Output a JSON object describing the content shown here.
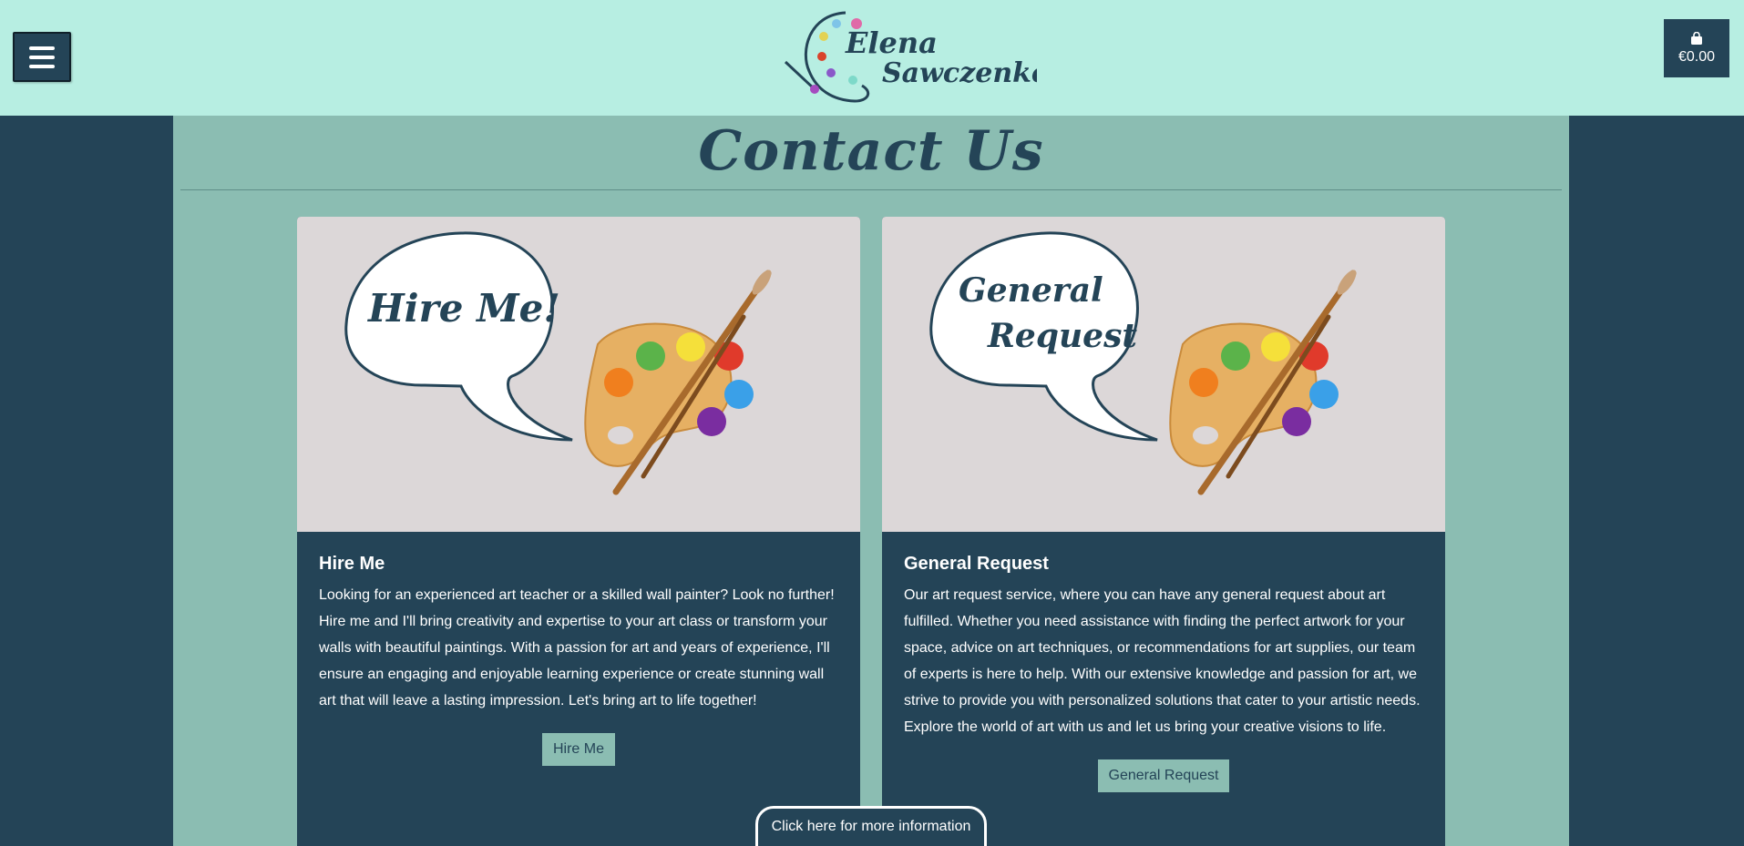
{
  "header": {
    "logo_line1": "Elena",
    "logo_line2": "Sawczenko",
    "cart_total": "€0.00",
    "menu_icon": "hamburger-menu-icon",
    "cart_icon": "shopping-bag-icon"
  },
  "page": {
    "title": "Contact Us"
  },
  "cards": [
    {
      "image_caption": "Hire Me!",
      "title": "Hire Me",
      "text": "Looking for an experienced art teacher or a skilled wall painter? Look no further! Hire me and I'll bring creativity and expertise to your art class or transform your walls with beautiful paintings. With a passion for art and years of experience, I'll ensure an engaging and enjoyable learning experience or create stunning wall art that will leave a lasting impression. Let's bring art to life together!",
      "button": "Hire Me"
    },
    {
      "image_caption_line1": "General",
      "image_caption_line2": "Request",
      "title": "General Request",
      "text": "Our art request service, where you can have any general request about art fulfilled. Whether you need assistance with finding the perfect artwork for your space, advice on art techniques, or recommendations for art supplies, our team of experts is here to help. With our extensive knowledge and passion for art, we strive to provide you with personalized solutions that cater to your artistic needs. Explore the world of art with us and let us bring your creative visions to life.",
      "button": "General Request"
    }
  ],
  "footer_tab": {
    "label": "Click here for more information"
  },
  "colors": {
    "header_bg": "#b7eee2",
    "dark": "#244457",
    "teal": "#8bbdb2",
    "image_bg": "#dcd7d8"
  }
}
